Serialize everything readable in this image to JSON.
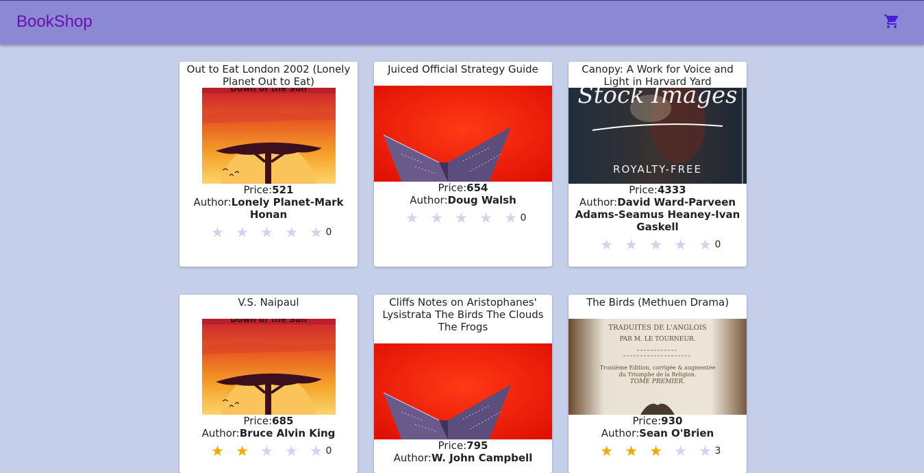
{
  "header": {
    "brand": "BookShop",
    "cart_icon": "shopping-cart-icon",
    "accent": "#8c89d4"
  },
  "labels": {
    "price": "Price:",
    "author": "Author:"
  },
  "books": [
    {
      "title": "Out to Eat London 2002 (Lonely Planet Out to Eat)",
      "cover": "sunset-tree",
      "price": "521",
      "author": "Lonely Planet-Mark Honan",
      "rating": 0,
      "count": "0"
    },
    {
      "title": "Juiced Official Strategy Guide",
      "cover": "paper-boat",
      "price": "654",
      "author": "Doug Walsh",
      "rating": 0,
      "count": "0"
    },
    {
      "title": "Canopy: A Work for Voice and Light in Harvard Yard",
      "cover": "stock-royalty-free",
      "price": "4333",
      "author": "David Ward-Parveen Adams-Seamus Heaney-Ivan Gaskell",
      "rating": 0,
      "count": "0"
    },
    {
      "title": "V.S. Naipaul",
      "cover": "sunset-tree",
      "price": "685",
      "author": "Bruce Alvin King",
      "rating": 2,
      "count": "0"
    },
    {
      "title": "Cliffs Notes on Aristophanes' Lysistrata The Birds The Clouds The Frogs",
      "cover": "paper-boat",
      "price": "795",
      "author": "W. John Campbell",
      "rating": 0,
      "count": ""
    },
    {
      "title": "The Birds (Methuen Drama)",
      "cover": "old-book",
      "price": "930",
      "author": "Sean O'Brien",
      "rating": 3,
      "count": "3"
    }
  ],
  "cover_text": {
    "stock_top": "Stock Images",
    "stock_bottom": "ROYALTY-FREE",
    "old_line1": "TRADUITES DE L'ANGLOIS",
    "old_line2": "PAR M. LE TOURNEUR.",
    "old_line3": "Troisième Edition, corrigée & augmentée",
    "old_line4": "du Triomphe de la Religion.",
    "old_line5": "TOME PREMIER.",
    "sunset_text": "Down of the Sun"
  }
}
